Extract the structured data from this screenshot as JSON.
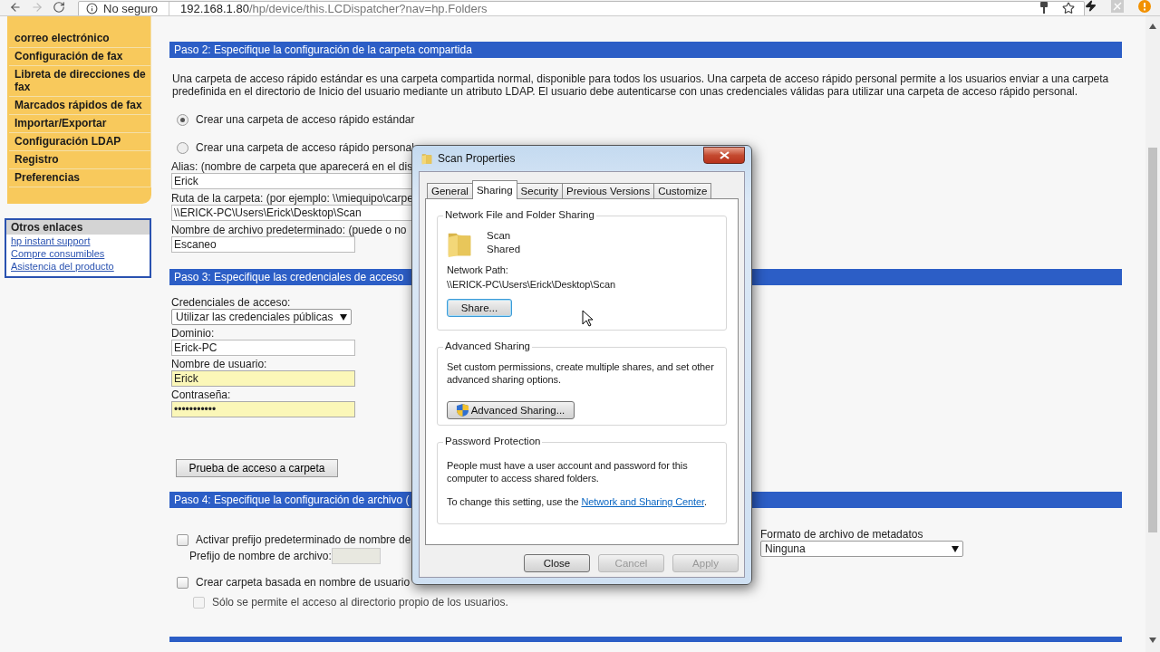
{
  "browser": {
    "back_disabled": false,
    "forward_disabled": true,
    "security_label": "No seguro",
    "url_host": "192.168.1.80",
    "url_path": "/hp/device/this.LCDispatcher?nav=hp.Folders"
  },
  "sidebar": {
    "items": [
      {
        "label": "correo electrónico"
      },
      {
        "label": "Configuración de fax"
      },
      {
        "label": "Libreta de direcciones de fax"
      },
      {
        "label": "Marcados rápidos de fax"
      },
      {
        "label": "Importar/Exportar"
      },
      {
        "label": "Configuración LDAP"
      },
      {
        "label": "Registro"
      },
      {
        "label": "Preferencias"
      }
    ],
    "other_links": {
      "title": "Otros enlaces",
      "links": [
        "hp instant support",
        "Compre consumibles",
        "Asistencia del producto"
      ]
    }
  },
  "step2": {
    "title": "Paso 2: Especifique la configuración de la carpeta compartida",
    "description_lines": [
      "Una carpeta de acceso rápido estándar es una carpeta compartida normal, disponible para todos los usuarios. Una carpeta de acceso rápido personal permite a los usuarios enviar a una carpeta",
      "predefinida en el directorio de Inicio del usuario mediante un atributo LDAP. El usuario debe autenticarse con unas credenciales válidas para utilizar una carpeta de acceso rápido personal."
    ],
    "folder_types": [
      {
        "label": "Crear una carpeta de acceso rápido estándar",
        "selected": true
      },
      {
        "label": "Crear una carpeta de acceso rápido personal",
        "selected": false
      }
    ],
    "fields": [
      {
        "label": "Alias: (nombre de carpeta que aparecerá en el dis",
        "value": "Erick",
        "wide": true
      },
      {
        "label": "Ruta de la carpeta: (por ejemplo: \\\\miequipo\\carpe",
        "value": "\\\\ERICK-PC\\Users\\Erick\\Desktop\\Scan",
        "wide": true
      },
      {
        "label": "Nombre de archivo predeterminado: (puede o no",
        "value": "Escaneo",
        "wide": false
      }
    ]
  },
  "step3": {
    "title": "Paso 3: Especifique las credenciales de acceso",
    "credentials_label": "Credenciales de acceso:",
    "credentials_value": "Utilizar las credenciales públicas",
    "fields": [
      {
        "label": "Dominio:",
        "value": "Erick-PC",
        "autofilled": false
      },
      {
        "label": "Nombre de usuario:",
        "value": "Erick",
        "autofilled": true
      },
      {
        "label": "Contraseña:",
        "value": "•••••••••••",
        "autofilled": true
      }
    ],
    "test_button": "Prueba de acceso a carpeta"
  },
  "step4": {
    "title": "Paso 4: Especifique la configuración de archivo (",
    "prefix_option": {
      "label": "Activar prefijo predeterminado de nombre de",
      "checked": false
    },
    "prefix_field": {
      "label": "Prefijo de nombre de archivo:",
      "disabled": true
    },
    "user_folder_option": {
      "label": "Crear carpeta basada en nombre de usuario",
      "checked": false
    },
    "own_dir_option": {
      "label": "Sólo se permite el acceso al directorio propio de los usuarios.",
      "checked": false,
      "disabled": true
    },
    "metadata": {
      "label": "Formato de archivo de metadatos",
      "value": "Ninguna"
    }
  },
  "dialog": {
    "title": "Scan Properties",
    "tabs": [
      {
        "label": "General",
        "selected": false
      },
      {
        "label": "Sharing",
        "selected": true
      },
      {
        "label": "Security",
        "selected": false
      },
      {
        "label": "Previous Versions",
        "selected": false
      },
      {
        "label": "Customize",
        "selected": false
      }
    ],
    "network_sharing": {
      "title": "Network File and Folder Sharing",
      "folder_name": "Scan",
      "folder_status": "Shared",
      "path_label": "Network Path:",
      "path": "\\\\ERICK-PC\\Users\\Erick\\Desktop\\Scan",
      "share_button": "Share..."
    },
    "advanced_sharing": {
      "title": "Advanced Sharing",
      "description": "Set custom permissions, create multiple shares, and set other advanced sharing options.",
      "button": "Advanced Sharing..."
    },
    "password_protection": {
      "title": "Password Protection",
      "description": "People must have a user account and password for this computer to access shared folders.",
      "change_prefix": "To change this setting, use the ",
      "link": "Network and Sharing Center",
      "change_suffix": "."
    },
    "buttons": [
      {
        "label": "Close",
        "disabled": false
      },
      {
        "label": "Cancel",
        "disabled": true
      },
      {
        "label": "Apply",
        "disabled": true
      }
    ]
  }
}
